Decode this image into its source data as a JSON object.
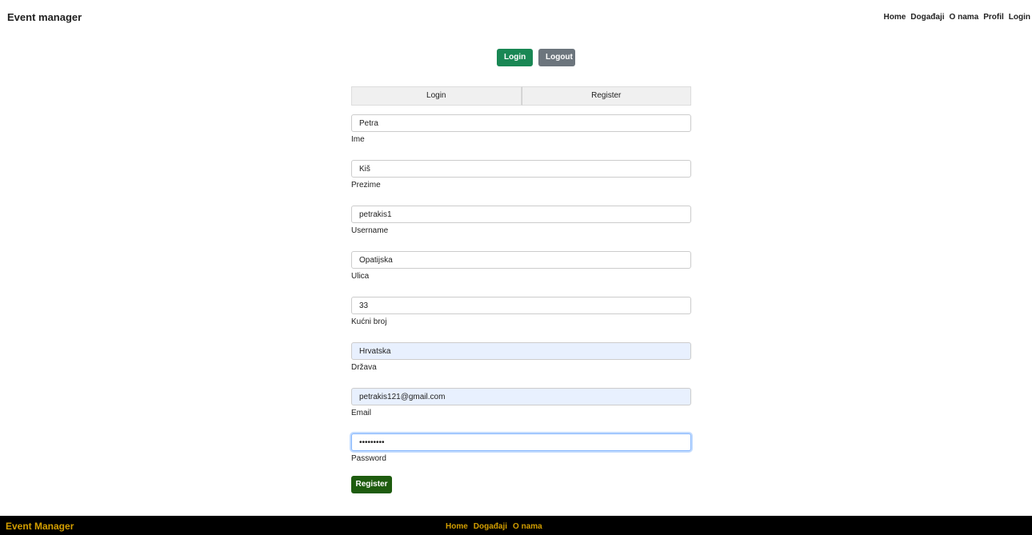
{
  "header": {
    "brand": "Event manager",
    "nav": [
      "Home",
      "Događaji",
      "O nama",
      "Profil",
      "Login"
    ]
  },
  "auth": {
    "login_label": "Login",
    "logout_label": "Logout"
  },
  "tabs": [
    "Login",
    "Register"
  ],
  "form": {
    "fields": [
      {
        "value": "Petra",
        "label": "Ime"
      },
      {
        "value": "Kiš",
        "label": "Prezime"
      },
      {
        "value": "petrakis1",
        "label": "Username"
      },
      {
        "value": "Opatijska",
        "label": "Ulica"
      },
      {
        "value": "33",
        "label": "Kućni broj"
      },
      {
        "value": "Hrvatska",
        "label": "Država"
      },
      {
        "value": "petrakis121@gmail.com",
        "label": "Email"
      },
      {
        "value": "•••••••••",
        "label": "Password"
      }
    ],
    "submit_label": "Register"
  },
  "footer": {
    "brand": "Event Manager",
    "nav": [
      "Home",
      "Događaji",
      "O nama"
    ]
  },
  "colors": {
    "login_button": "#198754",
    "logout_button": "#6c757d",
    "register_button": "#1e5c0f",
    "footer_bg": "#000000",
    "footer_text": "#d39e00",
    "autofill_bg": "#e8f0fe"
  }
}
